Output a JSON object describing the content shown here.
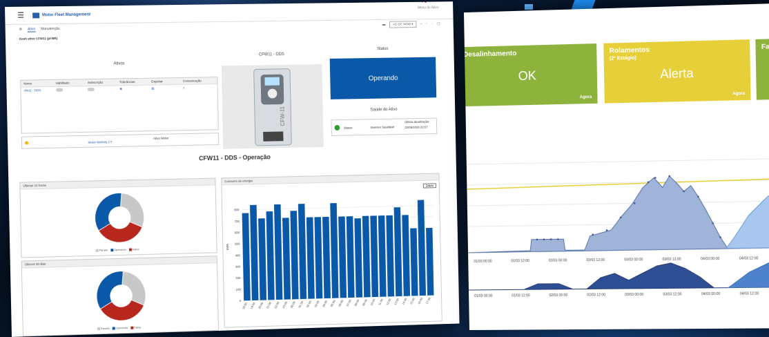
{
  "left_screen": {
    "app_title": "Motor Fleet Management",
    "topbar_right": "Menu do Ativo",
    "tabs": [
      "Ativo",
      "Manutenção"
    ],
    "page_subtitle": "Dash ativo CFW11 (pt-BR)",
    "date_select": "AS OF: NOW ▾",
    "ativos": {
      "title": "Ativos",
      "columns": [
        "Nome",
        "Habilitado",
        "Subscrição",
        "Tolerâncias",
        "Exportar",
        "Comunicação"
      ],
      "rows": [
        {
          "name": "cfw11 - DDS"
        }
      ],
      "bottom_link": "Motor Welinity CT",
      "bottom_label": "Ativo Motor"
    },
    "drive": {
      "title": "CFW11 - DDS"
    },
    "status": {
      "title": "Status",
      "value": "Operando"
    },
    "saude": {
      "title": "Saúde do Ativo",
      "label": "Status",
      "value": "Inversor Saudável",
      "update_label": "Última atualização:",
      "update_value": "22/09/2020 22:07"
    },
    "operacao_title": "CFW11 - DDS - Operação",
    "donut1": {
      "title": "Últimas 24 horas"
    },
    "donut2": {
      "title": "Últimos 30 dias"
    },
    "legend": [
      "Parado",
      "Operando",
      "Falha"
    ],
    "energy": {
      "title": "Consumo de energia",
      "select": "Diário",
      "ylabel": "kWh"
    }
  },
  "right_screen": {
    "cards": [
      {
        "title": "Desalinhamento",
        "sub": "",
        "value": "OK",
        "foot": "Agora"
      },
      {
        "title": "Rolamentos",
        "sub": "(2º Estágio)",
        "value": "Alerta",
        "foot": "Agora"
      },
      {
        "title": "Fa",
        "sub": "",
        "value": "",
        "foot": ""
      }
    ],
    "x_labels": [
      "01/03 00:00",
      "01/03 12:00",
      "02/03 00:00",
      "02/03 12:00",
      "03/03 00:00",
      "03/03 12:00",
      "04/03 00:00",
      "04/03 12:00"
    ]
  },
  "colors": {
    "blue": "#0a58a8",
    "green_card": "#8db33c",
    "yellow_card": "#e6cf38",
    "falha": "#b8271e",
    "parado": "#c8c8c8"
  },
  "chart_data": [
    {
      "type": "bar",
      "title": "Consumo de energia",
      "ylabel": "kWh",
      "ylim": [
        0,
        900
      ],
      "yticks": [
        0,
        100,
        200,
        300,
        400,
        500,
        600,
        700,
        800
      ],
      "categories": [
        "18:00",
        "19:00",
        "20:00",
        "21:00",
        "22:00",
        "23:00",
        "00:00",
        "01:00",
        "02:00",
        "03:00",
        "04:00",
        "05:00",
        "06:00",
        "07:00",
        "08:00",
        "09:00",
        "10:00",
        "11:00",
        "12:00",
        "13:00",
        "14:00",
        "15:00",
        "16:00",
        "17:00"
      ],
      "values": [
        770,
        840,
        720,
        780,
        840,
        720,
        780,
        840,
        720,
        720,
        720,
        840,
        720,
        720,
        700,
        720,
        720,
        720,
        720,
        790,
        720,
        600,
        850,
        600
      ]
    },
    {
      "type": "pie",
      "title": "Últimas 24 horas",
      "labels": [
        "Parado",
        "Operando",
        "Falha"
      ],
      "values": [
        30,
        35,
        35
      ]
    },
    {
      "type": "pie",
      "title": "Últimos 30 dias",
      "labels": [
        "Parado",
        "Operando",
        "Falha"
      ],
      "values": [
        30,
        35,
        35
      ]
    }
  ]
}
